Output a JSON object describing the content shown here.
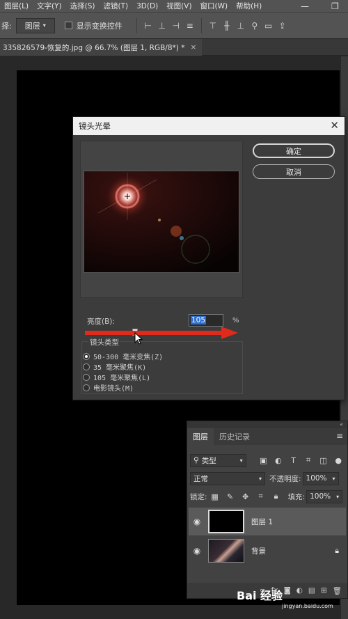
{
  "menubar": {
    "items": [
      "图层(L)",
      "文字(Y)",
      "选择(S)",
      "滤镜(T)",
      "3D(D)",
      "视图(V)",
      "窗口(W)",
      "帮助(H)"
    ],
    "minimize": "—",
    "restore": "❐"
  },
  "optbar": {
    "select_prefix": "择:",
    "select_value": "图层",
    "show_transform_label": "显示变换控件"
  },
  "document": {
    "tab_title": "335826579-恢复的.jpg @ 66.7% (图层 1, RGB/8*) *",
    "tab_close": "×"
  },
  "dialog": {
    "title": "镜头光晕",
    "close": "✕",
    "ok_label": "确定",
    "cancel_label": "取消",
    "brightness_label": "亮度(B):",
    "brightness_value": "105",
    "brightness_unit": "%",
    "brightness_slider_fraction": 0.35,
    "lens_type_label": "镜头类型",
    "lens_options": [
      "50-300 毫米变焦(Z)",
      "35 毫米聚焦(K)",
      "105 毫米聚焦(L)",
      "电影镜头(M)"
    ],
    "lens_selected_index": 0
  },
  "layers_panel": {
    "collapse": "«",
    "tabs": [
      "图层",
      "历史记录"
    ],
    "menu": "≡",
    "filter_label": "类型",
    "blend_mode": "正常",
    "opacity_label": "不透明度:",
    "opacity_value": "100%",
    "lock_label": "锁定:",
    "fill_label": "填充:",
    "fill_value": "100%",
    "layers": [
      {
        "name": "图层 1",
        "selected": true
      },
      {
        "name": "背景",
        "locked": true
      }
    ],
    "footer_fx": "fx"
  },
  "watermark": {
    "text": "Bai 经验",
    "sub": "jingyan.baidu.com"
  },
  "colors": {
    "accent_arrow": "#e02a1c",
    "selection_blue": "#2f6fd0"
  }
}
